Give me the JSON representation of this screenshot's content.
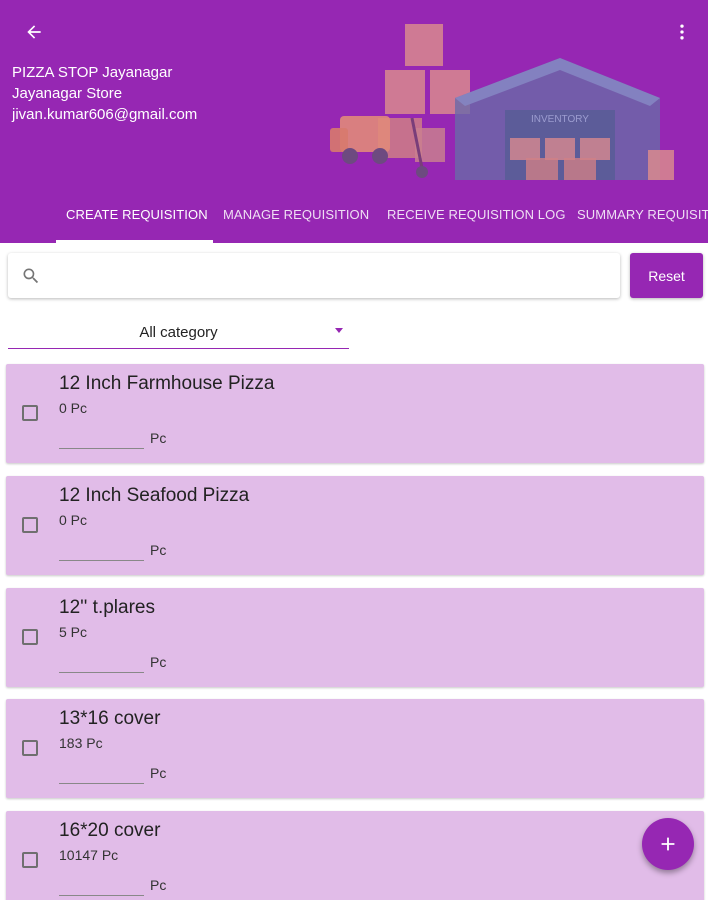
{
  "header": {
    "back_icon": "arrow-left-icon",
    "menu_icon": "more-vert-icon",
    "store_name": "PIZZA STOP Jayanagar",
    "store_branch": "Jayanagar Store",
    "user_email": "jivan.kumar606@gmail.com",
    "illustration_label": "INVENTORY"
  },
  "tabs": [
    {
      "label": "CREATE REQUISITION",
      "active": true
    },
    {
      "label": "MANAGE REQUISITION",
      "active": false
    },
    {
      "label": "RECEIVE REQUISITION LOG",
      "active": false
    },
    {
      "label": "SUMMARY REQUISITI",
      "active": false
    }
  ],
  "search": {
    "placeholder": "",
    "value": "",
    "icon": "search-icon"
  },
  "reset_label": "Reset",
  "category": {
    "selected": "All category"
  },
  "items": [
    {
      "name": "12 Inch Farmhouse Pizza",
      "stock": "0 Pc",
      "unit": "Pc",
      "qty": ""
    },
    {
      "name": "12 Inch Seafood Pizza",
      "stock": "0 Pc",
      "unit": "Pc",
      "qty": ""
    },
    {
      "name": "12'' t.plares",
      "stock": "5 Pc",
      "unit": "Pc",
      "qty": ""
    },
    {
      "name": "13*16 cover",
      "stock": "183 Pc",
      "unit": "Pc",
      "qty": ""
    },
    {
      "name": "16*20 cover",
      "stock": "10147 Pc",
      "unit": "Pc",
      "qty": ""
    }
  ],
  "fab_icon": "plus-icon",
  "colors": {
    "primary": "#9627b3",
    "card": "#e1bce8"
  }
}
